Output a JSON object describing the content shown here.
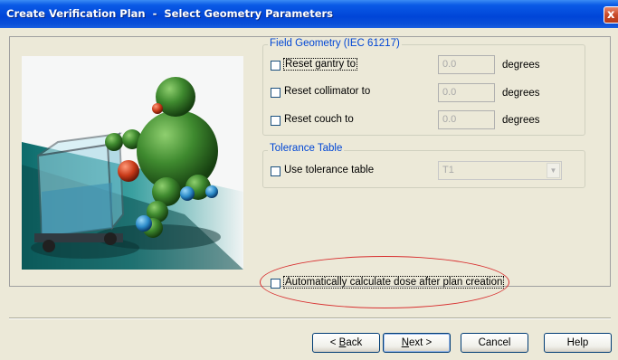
{
  "window": {
    "title": "Create Verification Plan  -  Select Geometry Parameters",
    "close_label": "x"
  },
  "field_geometry": {
    "title": "Field Geometry (IEC 61217)",
    "rows": [
      {
        "label": "Reset gantry to",
        "value": "0.0",
        "unit": "degrees",
        "checked": false
      },
      {
        "label": "Reset collimator to",
        "value": "0.0",
        "unit": "degrees",
        "checked": false
      },
      {
        "label": "Reset couch to",
        "value": "0.0",
        "unit": "degrees",
        "checked": false
      }
    ]
  },
  "tolerance_table": {
    "title": "Tolerance Table",
    "use_label": "Use tolerance table",
    "checked": false,
    "selected": "T1"
  },
  "auto_calc": {
    "label": "Automatically calculate dose after plan creation",
    "checked": false
  },
  "buttons": {
    "back_prefix": "< ",
    "back_mnemonic": "B",
    "back_rest": "ack",
    "next_mnemonic": "N",
    "next_rest": "ext >",
    "cancel": "Cancel",
    "help": "Help"
  },
  "colors": {
    "title_blue": "#0046d5",
    "highlight_red": "#d83030"
  }
}
